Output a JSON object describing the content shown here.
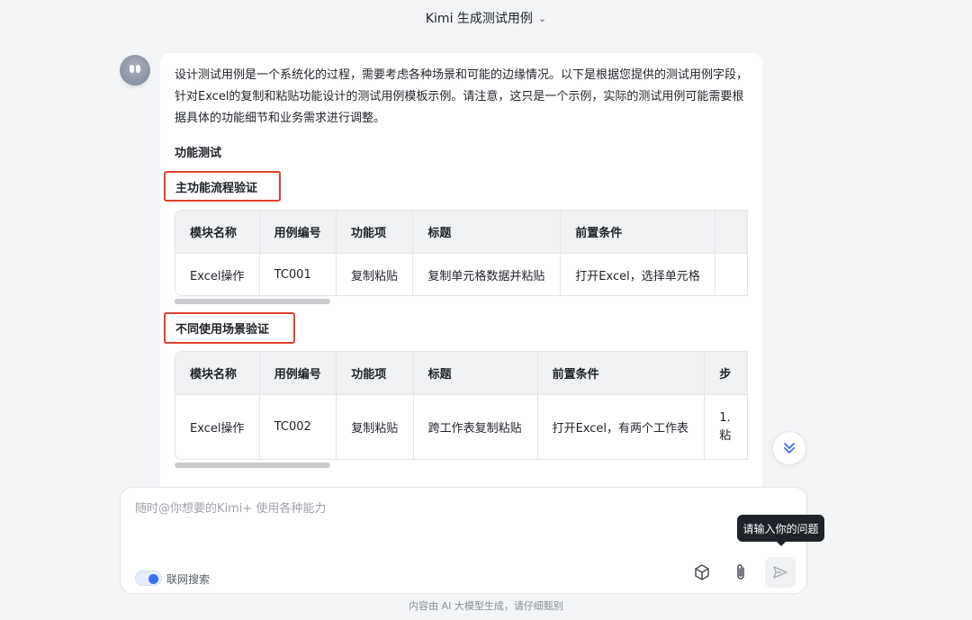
{
  "header": {
    "title": "Kimi 生成测试用例"
  },
  "message": {
    "paragraph": "设计测试用例是一个系统化的过程，需要考虑各种场景和可能的边缘情况。以下是根据您提供的测试用例字段，针对Excel的复制和粘贴功能设计的测试用例模板示例。请注意，这只是一个示例，实际的测试用例可能需要根据具体的功能细节和业务需求进行调整。",
    "section_title": "功能测试",
    "table1": {
      "heading": "主功能流程验证",
      "columns": [
        "模块名称",
        "用例编号",
        "功能项",
        "标题",
        "前置条件",
        ""
      ],
      "row": [
        "Excel操作",
        "TC001",
        "复制粘贴",
        "复制单元格数据并粘贴",
        "打开Excel，选择单元格",
        ""
      ]
    },
    "table2": {
      "heading": "不同使用场景验证",
      "columns": [
        "模块名称",
        "用例编号",
        "功能项",
        "标题",
        "前置条件",
        "步"
      ],
      "row": [
        "Excel操作",
        "TC002",
        "复制粘贴",
        "跨工作表复制粘贴",
        "打开Excel，有两个工作表",
        "1.\n粘"
      ]
    }
  },
  "composer": {
    "placeholder": "随时@你想要的Kimi+ 使用各种能力",
    "search_toggle_label": "联网搜索",
    "search_toggle_on": true,
    "tooltip": "请输入你的问题"
  },
  "icons": {
    "cube": "cube-icon",
    "attach": "paperclip-icon",
    "send": "send-icon",
    "scroll_down": "double-chevron-down-icon"
  },
  "footer": {
    "disclaimer": "内容由 AI 大模型生成，请仔细甄别"
  },
  "colors": {
    "accent": "#3b6ef5",
    "highlight_box": "#e0412e"
  }
}
